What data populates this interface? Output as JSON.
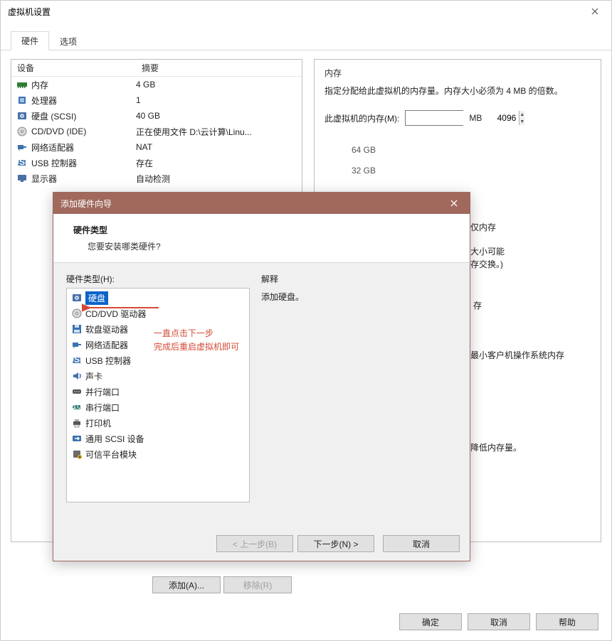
{
  "parent": {
    "title": "虚拟机设置",
    "tabs": {
      "hardware": "硬件",
      "options": "选项"
    },
    "columns": {
      "device": "设备",
      "summary": "摘要"
    },
    "devices": [
      {
        "icon": "memory",
        "name": "内存",
        "summary": "4 GB"
      },
      {
        "icon": "cpu",
        "name": "处理器",
        "summary": "1"
      },
      {
        "icon": "disk",
        "name": "硬盘 (SCSI)",
        "summary": "40 GB"
      },
      {
        "icon": "cd",
        "name": "CD/DVD (IDE)",
        "summary": "正在使用文件 D:\\云计算\\Linu..."
      },
      {
        "icon": "net",
        "name": "网络适配器",
        "summary": "NAT"
      },
      {
        "icon": "usb",
        "name": "USB 控制器",
        "summary": "存在"
      },
      {
        "icon": "display",
        "name": "显示器",
        "summary": "自动检测"
      }
    ],
    "memory": {
      "group": "内存",
      "desc": "指定分配给此虚拟机的内存量。内存大小必须为 4 MB 的倍数。",
      "label": "此虚拟机的内存(M):",
      "value": "4096",
      "unit": "MB",
      "ticks": [
        "64 GB",
        "32 GB"
      ],
      "extra1": "仅内存",
      "extra2": "大小可能",
      "extra3": "存交换。)",
      "extra4": "存",
      "extra5": "最小客户机操作系统内存",
      "extra6": "降低内存量。"
    },
    "buttons": {
      "add": "添加(A)...",
      "remove": "移除(R)",
      "ok": "确定",
      "cancel": "取消",
      "help": "帮助"
    }
  },
  "wizard": {
    "title": "添加硬件向导",
    "header": {
      "title": "硬件类型",
      "sub": "您要安装哪类硬件?"
    },
    "list_label": "硬件类型(H):",
    "explain_label": "解释",
    "explain_text": "添加硬盘。",
    "items": [
      {
        "icon": "disk",
        "label": "硬盘"
      },
      {
        "icon": "cd",
        "label": "CD/DVD 驱动器"
      },
      {
        "icon": "floppy",
        "label": "软盘驱动器"
      },
      {
        "icon": "net",
        "label": "网络适配器"
      },
      {
        "icon": "usb",
        "label": "USB 控制器"
      },
      {
        "icon": "sound",
        "label": "声卡"
      },
      {
        "icon": "parallel",
        "label": "并行端口"
      },
      {
        "icon": "serial",
        "label": "串行端口"
      },
      {
        "icon": "printer",
        "label": "打印机"
      },
      {
        "icon": "scsi",
        "label": "通用 SCSI 设备"
      },
      {
        "icon": "tpm",
        "label": "可信平台模块"
      }
    ],
    "buttons": {
      "back": "< 上一步(B)",
      "next": "下一步(N) >",
      "cancel": "取消"
    }
  },
  "annotation": {
    "line1": "一直点击下一步",
    "line2": "完成后重启虚拟机即可"
  }
}
